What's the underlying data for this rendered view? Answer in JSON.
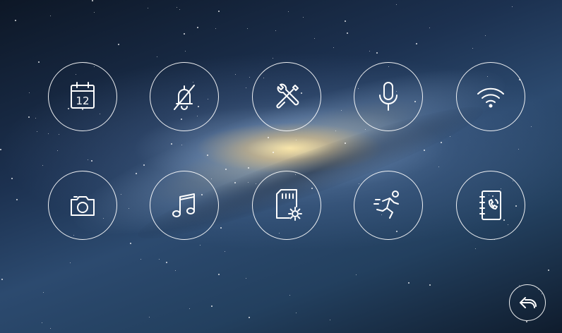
{
  "calendar_icon": {
    "day": "12",
    "icon": "calendar-icon"
  },
  "grid": {
    "row1": [
      "calendar-icon",
      "bell-mute-icon",
      "tools-icon",
      "microphone-icon",
      "wifi-icon"
    ],
    "row2": [
      "camera-icon",
      "music-note-icon",
      "sd-card-settings-icon",
      "running-person-icon",
      "phonebook-icon"
    ]
  },
  "back": {
    "icon": "back-arrow-icon"
  },
  "colors": {
    "icon_stroke": "#ffffff",
    "background_dark": "#0d1726",
    "galaxy_core": "#ffecaa"
  }
}
